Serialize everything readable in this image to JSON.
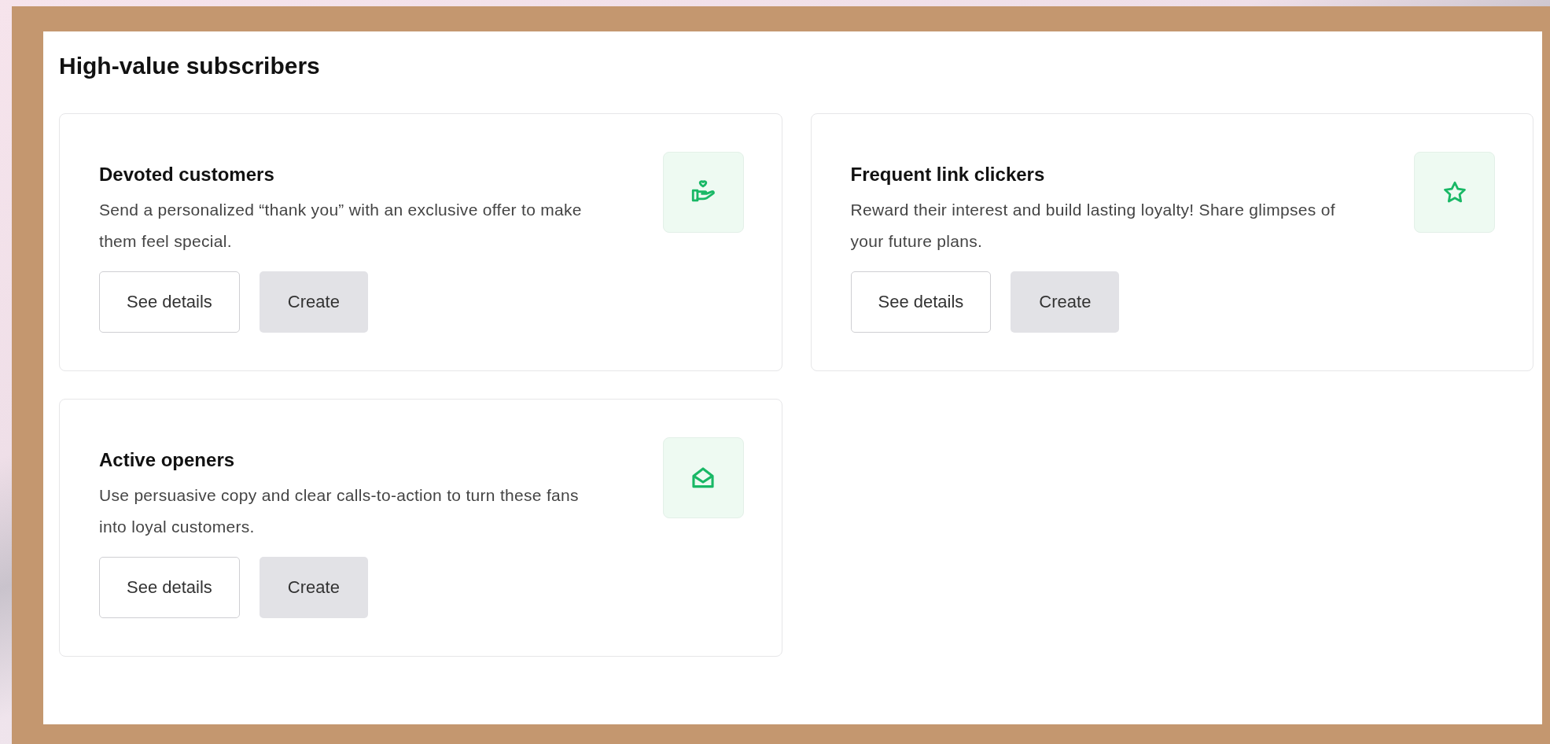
{
  "heading": "High-value subscribers",
  "cards": [
    {
      "title": "Devoted customers",
      "description": "Send a personalized “thank you” with an exclusive offer to make them feel special.",
      "buttons": [
        {
          "label": "See details",
          "kind": "secondary"
        },
        {
          "label": "Create",
          "kind": "primary"
        }
      ]
    },
    {
      "title": "Frequent link clickers",
      "description": "Reward their interest and build lasting loyalty! Share glimpses of your future plans.",
      "buttons": [
        {
          "label": "See details",
          "kind": "secondary"
        },
        {
          "label": "Create",
          "kind": "primary"
        }
      ]
    },
    {
      "title": "Active openers",
      "description": "Use persuasive copy and clear calls-to-action to turn these fans into loyal customers.",
      "buttons": [
        {
          "label": "See details",
          "kind": "secondary"
        },
        {
          "label": "Create",
          "kind": "primary"
        }
      ]
    }
  ]
}
